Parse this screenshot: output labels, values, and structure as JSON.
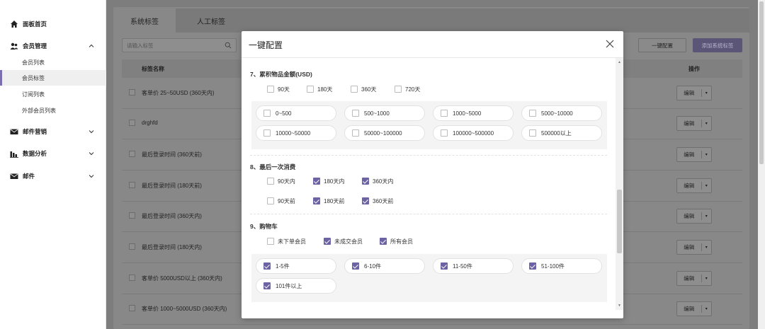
{
  "sidebar": {
    "items": [
      {
        "label": "面板首页",
        "icon": "home-icon"
      },
      {
        "label": "会员管理",
        "icon": "members-icon"
      },
      {
        "label": "邮件营销",
        "icon": "mail-icon"
      },
      {
        "label": "数据分析",
        "icon": "bar-chart-icon"
      },
      {
        "label": "邮件",
        "icon": "mail-icon"
      }
    ],
    "sub_items": [
      "会员列表",
      "会员标签",
      "订阅列表",
      "外部会员列表"
    ]
  },
  "main": {
    "tabs": [
      "系统标签",
      "人工标签"
    ],
    "search_placeholder": "请输入标签",
    "config_button": "一键配置",
    "add_button": "添加系统标签",
    "col_name": "标签名称",
    "col_action": "操作",
    "edit_label": "编辑",
    "rows": [
      "客单价 25~50USD (360天内)",
      "drghfd",
      "最后登录时间 (360天前)",
      "最后登录时间 (180天前)",
      "最后登录时间 (360天内)",
      "最后登录时间 (180天内)",
      "客单价 5000USD以上 (360天内)",
      "客单价 1000~5000USD (360天内)"
    ]
  },
  "modal": {
    "title": "一键配置",
    "sec7": {
      "title": "7、累积物品金额(USD)",
      "periods": [
        {
          "label": "90天",
          "checked": false
        },
        {
          "label": "180天",
          "checked": false
        },
        {
          "label": "360天",
          "checked": false
        },
        {
          "label": "720天",
          "checked": false
        }
      ],
      "ranges": [
        {
          "label": "0~500",
          "checked": false
        },
        {
          "label": "500~1000",
          "checked": false
        },
        {
          "label": "1000~5000",
          "checked": false
        },
        {
          "label": "5000~10000",
          "checked": false
        },
        {
          "label": "10000~50000",
          "checked": false
        },
        {
          "label": "50000~100000",
          "checked": false
        },
        {
          "label": "100000~500000",
          "checked": false
        },
        {
          "label": "500000以上",
          "checked": false
        }
      ]
    },
    "sec8": {
      "title": "8、最后一次消费",
      "options": [
        {
          "label": "90天内",
          "checked": false
        },
        {
          "label": "180天内",
          "checked": true
        },
        {
          "label": "360天内",
          "checked": true
        },
        {
          "label": "90天前",
          "checked": false
        },
        {
          "label": "180天前",
          "checked": true
        },
        {
          "label": "360天前",
          "checked": true
        }
      ]
    },
    "sec9": {
      "title": "9、购物车",
      "options": [
        {
          "label": "未下单会员",
          "checked": false
        },
        {
          "label": "未成交会员",
          "checked": true
        },
        {
          "label": "所有会员",
          "checked": true
        }
      ],
      "ranges": [
        {
          "label": "1-5件",
          "checked": true
        },
        {
          "label": "6-10件",
          "checked": true
        },
        {
          "label": "11-50件",
          "checked": true
        },
        {
          "label": "51-100件",
          "checked": true
        },
        {
          "label": "101件以上",
          "checked": true
        }
      ]
    }
  },
  "colors": {
    "accent": "#6b63a3",
    "overlay": "#7d7d7d"
  }
}
